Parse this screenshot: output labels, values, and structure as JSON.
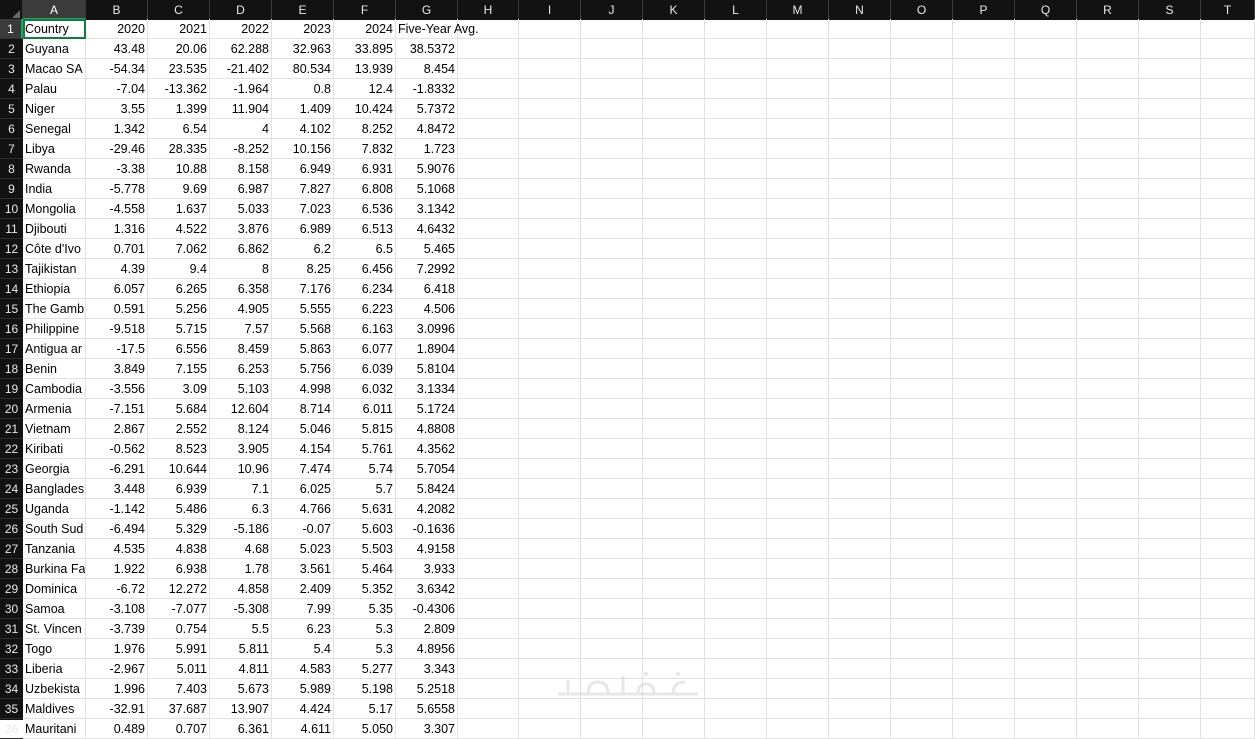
{
  "columns": [
    "A",
    "B",
    "C",
    "D",
    "E",
    "F",
    "G",
    "H",
    "I",
    "J",
    "K",
    "L",
    "M",
    "N",
    "O",
    "P",
    "Q",
    "R",
    "S",
    "T"
  ],
  "row_numbers": [
    "1",
    "2",
    "3",
    "4",
    "5",
    "6",
    "7",
    "8",
    "9",
    "10",
    "11",
    "12",
    "13",
    "14",
    "15",
    "16",
    "17",
    "18",
    "19",
    "20",
    "21",
    "22",
    "23",
    "24",
    "25",
    "26",
    "27",
    "28",
    "29",
    "30",
    "31",
    "32",
    "33",
    "34",
    "35",
    "36"
  ],
  "header": [
    "Country",
    "2020",
    "2021",
    "2022",
    "2023",
    "2024",
    "Five-Year Avg."
  ],
  "rows": [
    [
      "Guyana",
      "43.48",
      "20.06",
      "62.288",
      "32.963",
      "33.895",
      "38.5372"
    ],
    [
      "Macao SA",
      "-54.34",
      "23.535",
      "-21.402",
      "80.534",
      "13.939",
      "8.454"
    ],
    [
      "Palau",
      "-7.04",
      "-13.362",
      "-1.964",
      "0.8",
      "12.4",
      "-1.8332"
    ],
    [
      "Niger",
      "3.55",
      "1.399",
      "11.904",
      "1.409",
      "10.424",
      "5.7372"
    ],
    [
      "Senegal",
      "1.342",
      "6.54",
      "4",
      "4.102",
      "8.252",
      "4.8472"
    ],
    [
      "Libya",
      "-29.46",
      "28.335",
      "-8.252",
      "10.156",
      "7.832",
      "1.723"
    ],
    [
      "Rwanda",
      "-3.38",
      "10.88",
      "8.158",
      "6.949",
      "6.931",
      "5.9076"
    ],
    [
      "India",
      "-5.778",
      "9.69",
      "6.987",
      "7.827",
      "6.808",
      "5.1068"
    ],
    [
      "Mongolia",
      "-4.558",
      "1.637",
      "5.033",
      "7.023",
      "6.536",
      "3.1342"
    ],
    [
      "Djibouti",
      "1.316",
      "4.522",
      "3.876",
      "6.989",
      "6.513",
      "4.6432"
    ],
    [
      "Côte d'Ivo",
      "0.701",
      "7.062",
      "6.862",
      "6.2",
      "6.5",
      "5.465"
    ],
    [
      "Tajikistan",
      "4.39",
      "9.4",
      "8",
      "8.25",
      "6.456",
      "7.2992"
    ],
    [
      "Ethiopia",
      "6.057",
      "6.265",
      "6.358",
      "7.176",
      "6.234",
      "6.418"
    ],
    [
      "The Gamb",
      "0.591",
      "5.256",
      "4.905",
      "5.555",
      "6.223",
      "4.506"
    ],
    [
      "Philippine",
      "-9.518",
      "5.715",
      "7.57",
      "5.568",
      "6.163",
      "3.0996"
    ],
    [
      "Antigua ar",
      "-17.5",
      "6.556",
      "8.459",
      "5.863",
      "6.077",
      "1.8904"
    ],
    [
      "Benin",
      "3.849",
      "7.155",
      "6.253",
      "5.756",
      "6.039",
      "5.8104"
    ],
    [
      "Cambodia",
      "-3.556",
      "3.09",
      "5.103",
      "4.998",
      "6.032",
      "3.1334"
    ],
    [
      "Armenia",
      "-7.151",
      "5.684",
      "12.604",
      "8.714",
      "6.011",
      "5.1724"
    ],
    [
      "Vietnam",
      "2.867",
      "2.552",
      "8.124",
      "5.046",
      "5.815",
      "4.8808"
    ],
    [
      "Kiribati",
      "-0.562",
      "8.523",
      "3.905",
      "4.154",
      "5.761",
      "4.3562"
    ],
    [
      "Georgia",
      "-6.291",
      "10.644",
      "10.96",
      "7.474",
      "5.74",
      "5.7054"
    ],
    [
      "Banglades",
      "3.448",
      "6.939",
      "7.1",
      "6.025",
      "5.7",
      "5.8424"
    ],
    [
      "Uganda",
      "-1.142",
      "5.486",
      "6.3",
      "4.766",
      "5.631",
      "4.2082"
    ],
    [
      "South Sud",
      "-6.494",
      "5.329",
      "-5.186",
      "-0.07",
      "5.603",
      "-0.1636"
    ],
    [
      "Tanzania",
      "4.535",
      "4.838",
      "4.68",
      "5.023",
      "5.503",
      "4.9158"
    ],
    [
      "Burkina Fa",
      "1.922",
      "6.938",
      "1.78",
      "3.561",
      "5.464",
      "3.933"
    ],
    [
      "Dominica",
      "-6.72",
      "12.272",
      "4.858",
      "2.409",
      "5.352",
      "3.6342"
    ],
    [
      "Samoa",
      "-3.108",
      "-7.077",
      "-5.308",
      "7.99",
      "5.35",
      "-0.4306"
    ],
    [
      "St. Vincen",
      "-3.739",
      "0.754",
      "5.5",
      "6.23",
      "5.3",
      "2.809"
    ],
    [
      "Togo",
      "1.976",
      "5.991",
      "5.811",
      "5.4",
      "5.3",
      "4.8956"
    ],
    [
      "Liberia",
      "-2.967",
      "5.011",
      "4.811",
      "4.583",
      "5.277",
      "3.343"
    ],
    [
      "Uzbekista",
      "1.996",
      "7.403",
      "5.673",
      "5.989",
      "5.198",
      "5.2518"
    ],
    [
      "Maldives",
      "-32.91",
      "37.687",
      "13.907",
      "4.424",
      "5.17",
      "5.6558"
    ],
    [
      "Mauritani",
      "0.489",
      "0.707",
      "6.361",
      "4.611",
      "5.050",
      "3.307"
    ]
  ],
  "watermark_text": "خمسات"
}
